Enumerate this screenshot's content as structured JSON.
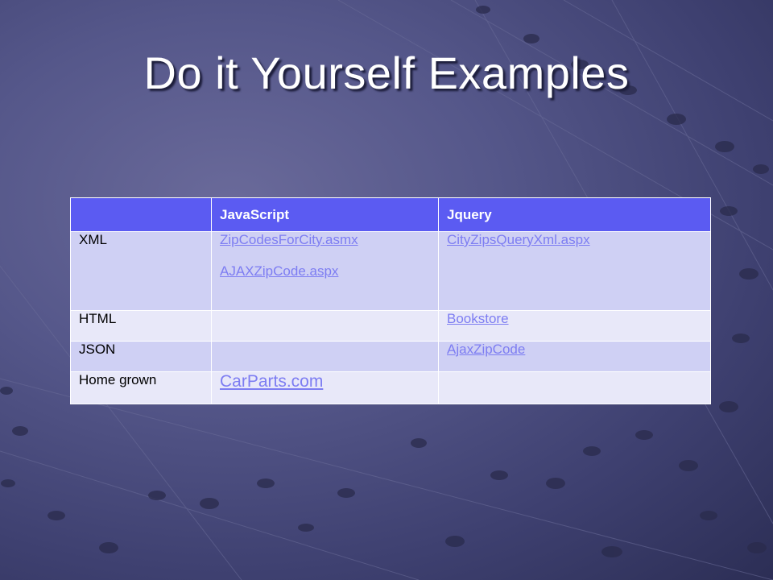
{
  "slide": {
    "title": "Do it Yourself Examples"
  },
  "table": {
    "headers": [
      "",
      "JavaScript",
      "Jquery"
    ],
    "rows": [
      {
        "label": "XML",
        "javascript": [
          "ZipCodesForCity.asmx",
          "AJAXZipCode.aspx"
        ],
        "jquery": [
          "CityZipsQueryXml.aspx"
        ]
      },
      {
        "label": "HTML",
        "javascript": [],
        "jquery": [
          "Bookstore"
        ]
      },
      {
        "label": "JSON",
        "javascript": [],
        "jquery": [
          "AjaxZipCode"
        ]
      },
      {
        "label": "Home grown",
        "javascript": [
          "CarParts.com"
        ],
        "jquery": []
      }
    ]
  },
  "colors": {
    "header_bg": "#5b5bf2",
    "row_odd_bg": "#cfd0f4",
    "row_even_bg": "#e8e8f9",
    "link": "#7d7df2",
    "background": "#4a4c7c"
  }
}
